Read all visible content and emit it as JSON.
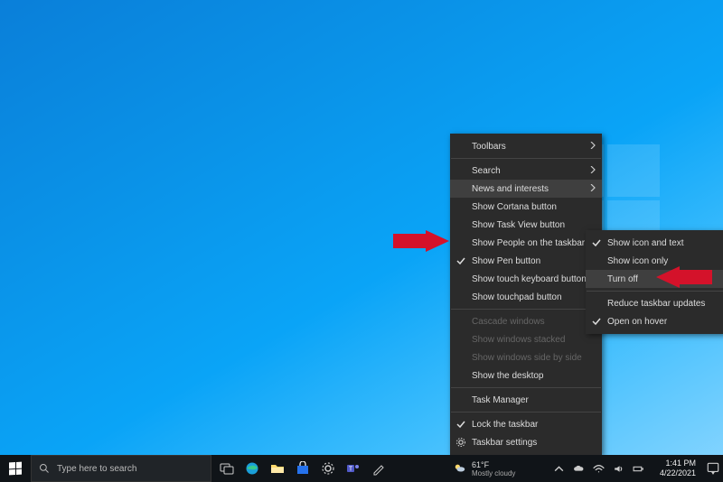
{
  "taskbar": {
    "search_placeholder": "Type here to search",
    "weather": {
      "temp": "61°F",
      "condition": "Mostly cloudy"
    },
    "clock": {
      "time": "1:41 PM",
      "date": "4/22/2021"
    }
  },
  "context_menu": {
    "toolbars": "Toolbars",
    "search": "Search",
    "news_and_interests": "News and interests",
    "show_cortana": "Show Cortana button",
    "show_task_view": "Show Task View button",
    "show_people": "Show People on the taskbar",
    "show_pen": "Show Pen button",
    "show_touch_keyboard": "Show touch keyboard button",
    "show_touchpad": "Show touchpad button",
    "cascade": "Cascade windows",
    "stacked": "Show windows stacked",
    "side_by_side": "Show windows side by side",
    "show_desktop": "Show the desktop",
    "task_manager": "Task Manager",
    "lock_taskbar": "Lock the taskbar",
    "taskbar_settings": "Taskbar settings"
  },
  "submenu": {
    "show_icon_text": "Show icon and text",
    "show_icon_only": "Show icon only",
    "turn_off": "Turn off",
    "reduce_updates": "Reduce taskbar updates",
    "open_on_hover": "Open on hover"
  },
  "colors": {
    "arrow": "#d4122a",
    "menu_bg": "#2b2b2b",
    "menu_highlight": "#3f3f3f"
  }
}
